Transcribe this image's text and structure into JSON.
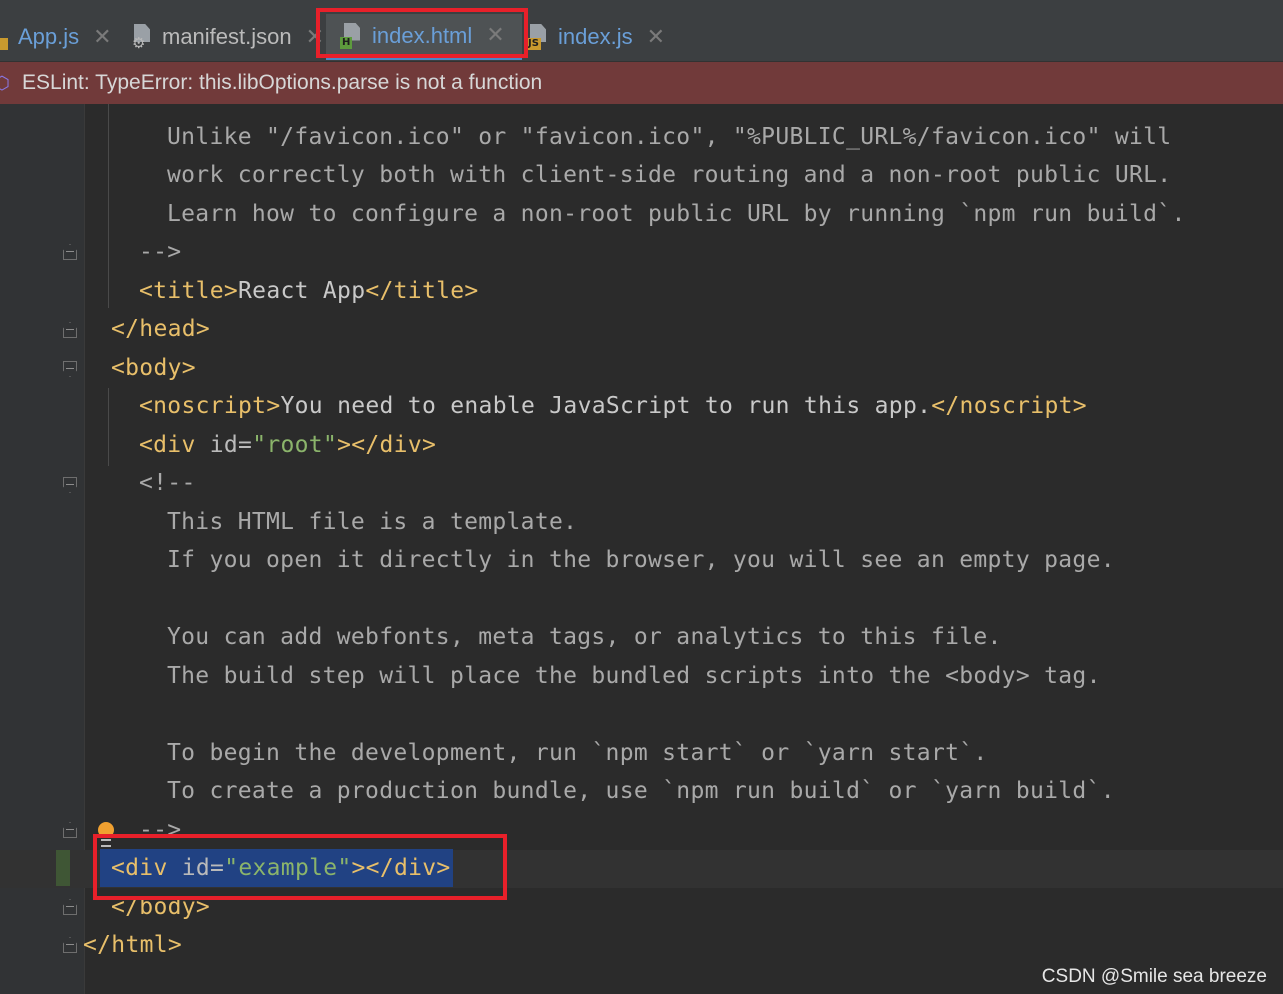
{
  "tabs": [
    {
      "label": "App.js",
      "icon": "js-file-icon"
    },
    {
      "label": "manifest.json",
      "icon": "json-file-icon"
    },
    {
      "label": "index.html",
      "icon": "html-file-icon",
      "active": true
    },
    {
      "label": "index.js",
      "icon": "js-file-icon"
    }
  ],
  "tab_badges": {
    "html": "H",
    "js": "JS"
  },
  "banner": {
    "message": "ESLint: TypeError: this.libOptions.parse is not a function"
  },
  "code": {
    "l1": "Unlike \"/favicon.ico\" or \"favicon.ico\", \"%PUBLIC_URL%/favicon.ico\" will",
    "l2": "work correctly both with client-side routing and a non-root public URL.",
    "l3": "Learn how to configure a non-root public URL by running `npm run build`.",
    "l4": "-->",
    "l5a": "<title>",
    "l5b": "React App",
    "l5c": "</title>",
    "l6": "</head>",
    "l7": "<body>",
    "l8a": "<noscript>",
    "l8b": "You need to enable JavaScript to run this app.",
    "l8c": "</noscript>",
    "l9a": "<div ",
    "l9b": "id=",
    "l9c": "\"root\"",
    "l9d": "></div>",
    "l10": "<!--",
    "l11": "This HTML file is a template.",
    "l12": "If you open it directly in the browser, you will see an empty page.",
    "l14": "You can add webfonts, meta tags, or analytics to this file.",
    "l15": "The build step will place the bundled scripts into the <body> tag.",
    "l17": "To begin the development, run `npm start` or `yarn start`.",
    "l18": "To create a production bundle, use `npm run build` or `yarn build`.",
    "l19": "-->",
    "l20a": "<div ",
    "l20b": "id=",
    "l20c": "\"example\"",
    "l20d": "></div>",
    "l21": "</body>",
    "l22": "</html>"
  },
  "watermark": "CSDN @Smile sea breeze",
  "colors": {
    "highlight_box": "#e8202a",
    "banner_bg": "#713a3a",
    "tag": "#e8bf6a",
    "attr_value": "#8bb46b",
    "selection": "#214283"
  }
}
